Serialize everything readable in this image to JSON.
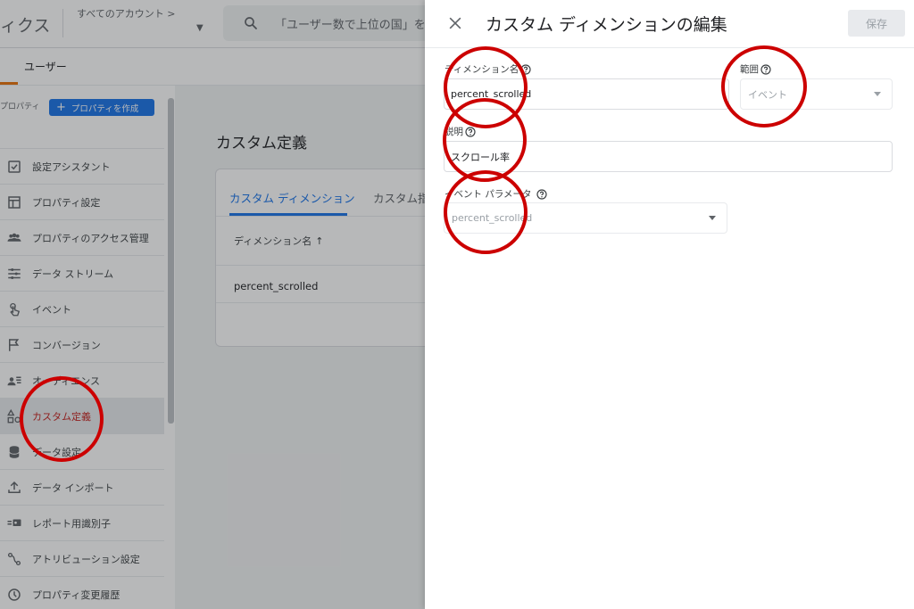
{
  "app": {
    "title_fragment": "ィクス"
  },
  "topbar": {
    "account_label": "すべてのアカウント >",
    "search_placeholder": "「ユーザー数で上位の国」を"
  },
  "subnav": {
    "tab_label": "ユーザー"
  },
  "sidebar": {
    "property_label": "プロパティ",
    "create_property_label": "プロパティを作成",
    "items": [
      {
        "label": "設定アシスタント",
        "icon": "checklist-icon"
      },
      {
        "label": "プロパティ設定",
        "icon": "property-settings-icon"
      },
      {
        "label": "プロパティのアクセス管理",
        "icon": "people-icon"
      },
      {
        "label": "データ ストリーム",
        "icon": "data-stream-icon"
      },
      {
        "label": "イベント",
        "icon": "touch-icon"
      },
      {
        "label": "コンバージョン",
        "icon": "flag-icon"
      },
      {
        "label": "オーディエンス",
        "icon": "audience-icon"
      },
      {
        "label": "カスタム定義",
        "icon": "custom-definitions-icon",
        "active": true
      },
      {
        "label": "データ設定",
        "icon": "database-icon"
      },
      {
        "label": "データ インポート",
        "icon": "upload-icon"
      },
      {
        "label": "レポート用識別子",
        "icon": "reporting-identity-icon"
      },
      {
        "label": "アトリビューション設定",
        "icon": "attribution-icon"
      },
      {
        "label": "プロパティ変更履歴",
        "icon": "history-icon"
      }
    ]
  },
  "main": {
    "page_title": "カスタム定義",
    "tabs": [
      {
        "label": "カスタム ディメンション",
        "active": true
      },
      {
        "label": "カスタム指標"
      }
    ],
    "table": {
      "column_header": "ディメンション名",
      "rows": [
        "percent_scrolled"
      ]
    }
  },
  "drawer": {
    "title": "カスタム ディメンションの編集",
    "save_label": "保存",
    "fields": {
      "dimension_name": {
        "label": "ディメンション名",
        "value": "percent_scrolled"
      },
      "scope": {
        "label": "範囲",
        "value": "イベント"
      },
      "description": {
        "label": "説明",
        "value": "スクロール率"
      },
      "event_parameter": {
        "label": "イベント パラメータ",
        "value": "percent_scrolled"
      }
    }
  },
  "colors": {
    "accent": "#1a73e8",
    "annotation": "#cc0000",
    "active_nav_text": "#c5221f"
  }
}
